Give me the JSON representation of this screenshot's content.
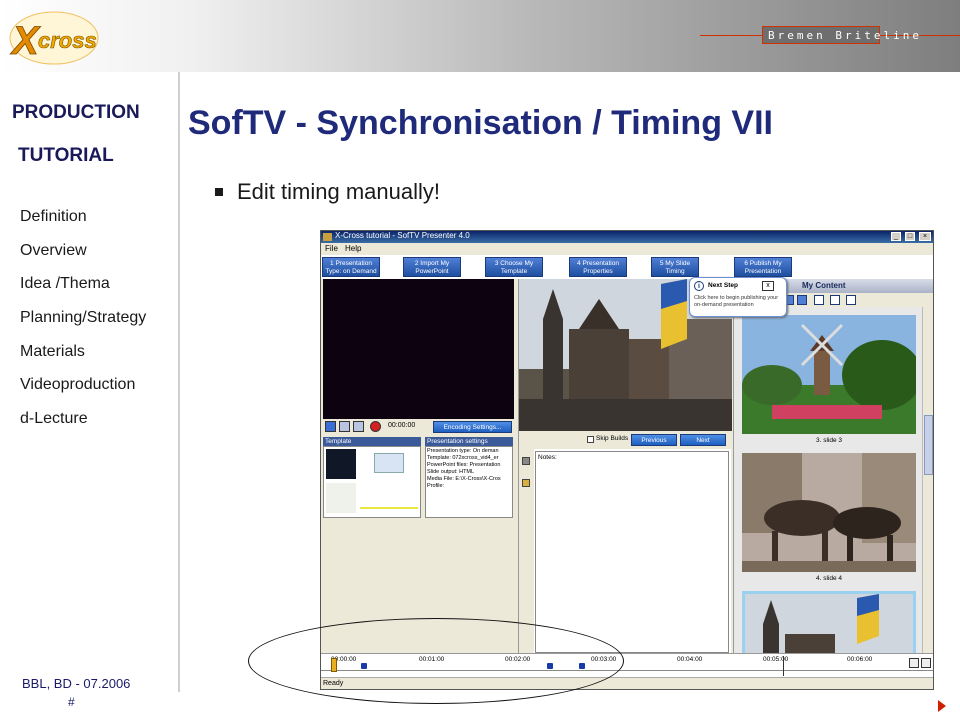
{
  "header": {
    "logo_text": "X-CROSS",
    "brand": "Bremen Briteline"
  },
  "sidebar": {
    "heading1": "PRODUCTION",
    "heading2": "TUTORIAL",
    "items": [
      "Definition",
      "Overview",
      "Idea /Thema",
      "Planning/Strategy",
      "Materials",
      "Videoproduction",
      "d-Lecture"
    ]
  },
  "footer": {
    "credit": "BBL, BD - 07.2006",
    "page": "#"
  },
  "slide": {
    "title": "SofTV - Synchronisation / Timing VII",
    "bullet": "Edit timing manually!"
  },
  "app": {
    "window_title": "X-Cross tutorial - SofTV Presenter 4.0",
    "menu": [
      "File",
      "Help"
    ],
    "steps": [
      {
        "line1": "1 Presentation",
        "line2": "Type: on Demand"
      },
      {
        "line1": "2 Import My",
        "line2": "PowerPoint"
      },
      {
        "line1": "3 Choose My",
        "line2": "Template"
      },
      {
        "line1": "4 Presentation",
        "line2": "Properties"
      },
      {
        "line1": "5 My Slide",
        "line2": "Timing"
      },
      {
        "line1": "6 Publish My",
        "line2": "Presentation"
      }
    ],
    "timecode": "00:00:00",
    "encoding_button": "Encoding Settings...",
    "template_header": "Template",
    "settings_header": "Presentation settings",
    "settings_lines": [
      "Presentation type: On deman",
      "Template: 072xcross_vid4_er",
      "PowerPoint files: Presentation",
      "Slide output: HTML",
      "Media File: E:\\X-Cross\\X-Cros",
      "Profile:"
    ],
    "skip_builds": "Skip Builds",
    "previous": "Previous",
    "next": "Next",
    "notes_label": "Notes:",
    "my_content": "My Content",
    "thumb_labels": [
      "3. slide 3",
      "4. slide 4"
    ],
    "tooltip": {
      "title": "Next Step",
      "text": "Click here to begin publishing your on-demand presentation",
      "close": "x"
    },
    "timeline_labels": [
      "00:00:00",
      "00:01:00",
      "00:02:00",
      "00:03:00",
      "00:04:00",
      "00:05:00",
      "00:06:00"
    ],
    "status": "Ready"
  },
  "colors": {
    "title": "#1f2a7a",
    "accent_blue": "#1f4f9f",
    "ellipse": "#111111"
  }
}
